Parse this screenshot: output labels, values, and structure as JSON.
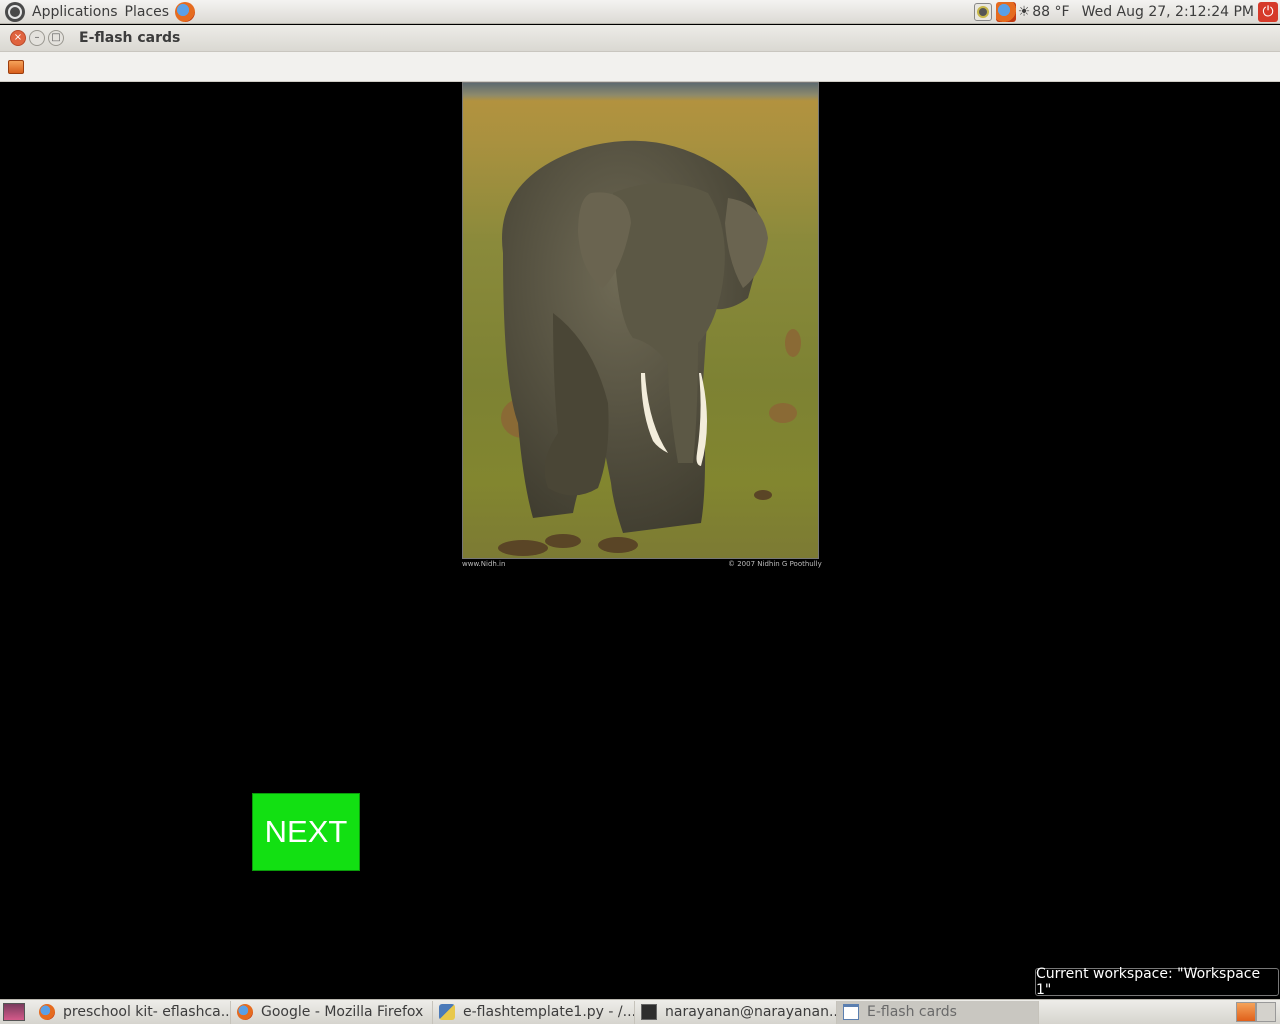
{
  "top_panel": {
    "applications": "Applications",
    "places": "Places",
    "weather": "88 °F",
    "clock": "Wed Aug 27,  2:12:24 PM"
  },
  "window": {
    "title": "E-flash cards"
  },
  "content": {
    "caption_left": "www.Nidh.in",
    "caption_right": "© 2007 Nidhin G Poothully",
    "next_label": "NEXT"
  },
  "tooltip": "Current workspace: \"Workspace 1\"",
  "taskbar": {
    "tasks": [
      {
        "label": "preschool kit- eflashca...",
        "icon": "firefox-icon"
      },
      {
        "label": "Google - Mozilla Firefox",
        "icon": "firefox-icon"
      },
      {
        "label": "e-flashtemplate1.py - /...",
        "icon": "python-file-icon"
      },
      {
        "label": "narayanan@narayanan...",
        "icon": "terminal-icon"
      },
      {
        "label": "E-flash cards",
        "icon": "window-icon"
      }
    ]
  },
  "colors": {
    "next_button": "#12e012",
    "background": "#000000"
  }
}
